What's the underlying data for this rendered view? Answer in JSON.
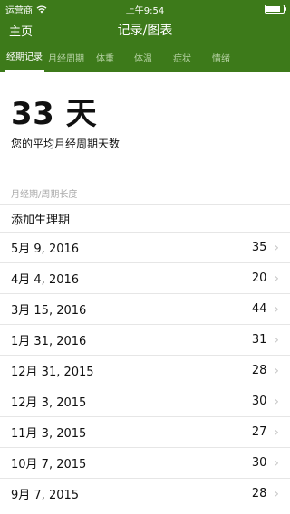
{
  "statusbar": {
    "carrier": "运营商",
    "time": "上午9:54",
    "battery_level": 0.85
  },
  "nav": {
    "back_label": "主页",
    "title": "记录/图表"
  },
  "tabs": [
    "经期记录",
    "月经周期",
    "体重",
    "体温",
    "症状",
    "情绪"
  ],
  "active_tab": 0,
  "summary": {
    "value": "33 天",
    "label": "您的平均月经周期天数"
  },
  "section_header": "月经期/周期长度",
  "add_label": "添加生理期",
  "records": [
    {
      "date": "5月 9, 2016",
      "days": "35"
    },
    {
      "date": "4月 4, 2016",
      "days": "20"
    },
    {
      "date": "3月 15, 2016",
      "days": "44"
    },
    {
      "date": "1月 31, 2016",
      "days": "31"
    },
    {
      "date": "12月 31, 2015",
      "days": "28"
    },
    {
      "date": "12月 3, 2015",
      "days": "30"
    },
    {
      "date": "11月 3, 2015",
      "days": "27"
    },
    {
      "date": "10月 7, 2015",
      "days": "30"
    },
    {
      "date": "9月 7, 2015",
      "days": "28"
    }
  ],
  "colors": {
    "header_green": "#3d7a1a",
    "chevron": "#c8c8c8"
  }
}
